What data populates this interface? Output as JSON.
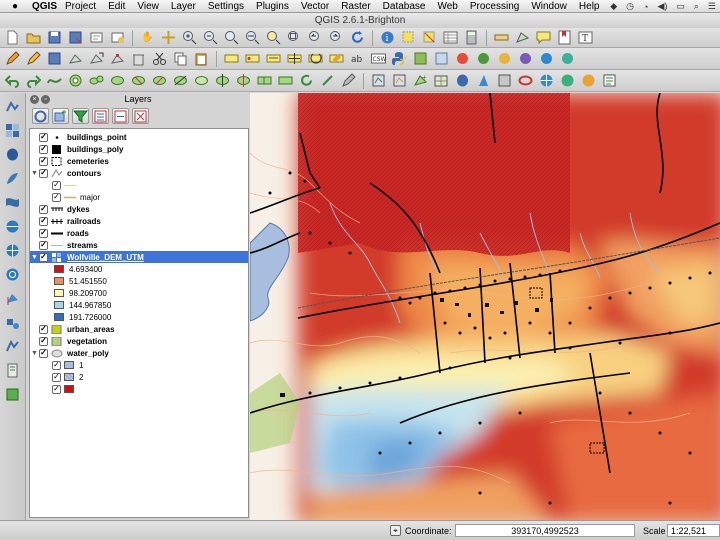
{
  "menubar": {
    "app": "QGIS",
    "items": [
      "Project",
      "Edit",
      "View",
      "Layer",
      "Settings",
      "Plugins",
      "Vector",
      "Raster",
      "Database",
      "Web",
      "Processing",
      "Window",
      "Help"
    ]
  },
  "window": {
    "title": "QGIS 2.6.1-Brighton"
  },
  "layers_panel": {
    "title": "Layers",
    "layers": [
      {
        "name": "buildings_point",
        "checked": true
      },
      {
        "name": "buildings_poly",
        "checked": true
      },
      {
        "name": "cemeteries",
        "checked": true
      },
      {
        "name": "contours",
        "checked": true,
        "expanded": true,
        "classes": [
          "",
          "major"
        ]
      },
      {
        "name": "dykes",
        "checked": true
      },
      {
        "name": "railroads",
        "checked": true
      },
      {
        "name": "roads",
        "checked": true
      },
      {
        "name": "streams",
        "checked": true
      },
      {
        "name": "Wolfville_DEM_UTM",
        "checked": true,
        "selected": true,
        "legend": [
          {
            "value": "4.693400",
            "color": "#c81414"
          },
          {
            "value": "51.451550",
            "color": "#e7945a"
          },
          {
            "value": "98.209700",
            "color": "#fbf6b4"
          },
          {
            "value": "144.967850",
            "color": "#a9d4ee"
          },
          {
            "value": "191.726000",
            "color": "#2f6fbe"
          }
        ]
      },
      {
        "name": "urban_areas",
        "checked": true,
        "color": "#c2d21a"
      },
      {
        "name": "vegetation",
        "checked": true,
        "color": "#b4d07c"
      },
      {
        "name": "water_poly",
        "checked": true,
        "expanded": true,
        "classes": [
          {
            "label": "1",
            "color": "#a8bede"
          },
          {
            "label": "2",
            "color": "#9db2d6"
          },
          {
            "label": "",
            "color": "#cc1111"
          }
        ]
      }
    ]
  },
  "statusbar": {
    "coordinate_label": "Coordinate:",
    "coordinate_value": "393170,4992523",
    "scale_label": "Scale",
    "scale_value": "1:22,521"
  }
}
